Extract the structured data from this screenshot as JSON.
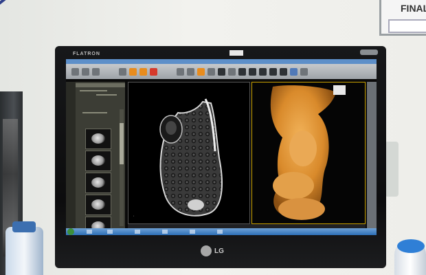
{
  "sign": {
    "text": "FINAL"
  },
  "monitor": {
    "top_brand": "FLATRON",
    "bottom_brand": "LG"
  },
  "viewer": {
    "toolbar_icon_count": 24,
    "left_panel": {
      "thumbnail_count": 5
    },
    "viewport_left": {
      "content": "MRI coronal slice (grayscale)"
    },
    "viewport_right": {
      "content": "3D volume rendering (orange)"
    }
  },
  "colors": {
    "wall": "#eeeeea",
    "bezel": "#0c0c0d",
    "taskbar": "#2d6fb6",
    "render_orange": "#d98a2b",
    "active_viewport_border": "#c8a000"
  }
}
